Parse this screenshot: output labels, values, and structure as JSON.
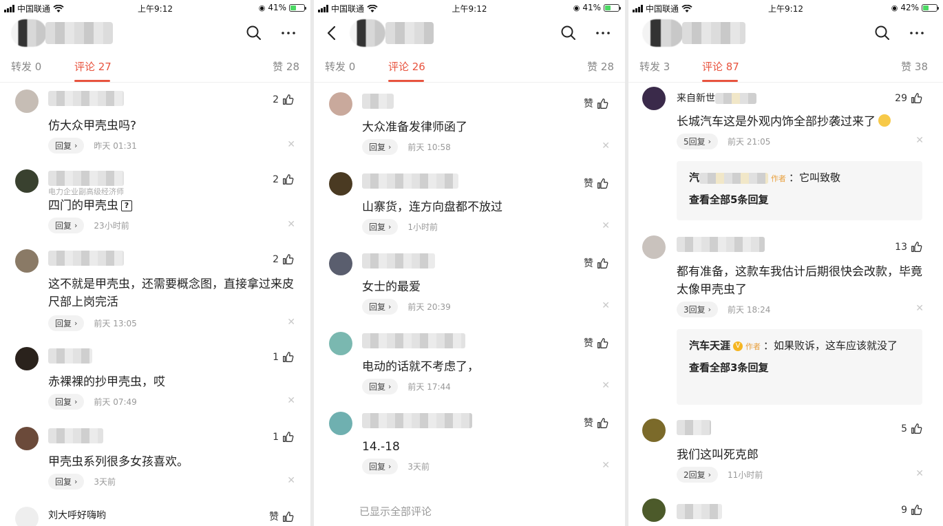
{
  "colors": {
    "accent": "#e8533e",
    "battery": "#4cd964"
  },
  "panels": [
    {
      "status": {
        "carrier": "中国联通",
        "time": "上午9:12",
        "battery": "41%",
        "battery_level": 0.41
      },
      "tabs": {
        "reposts": "转发 0",
        "comments": "评论 27",
        "likes": "赞 28"
      },
      "comments": [
        {
          "like": "2",
          "text": "仿大众甲壳虫吗?",
          "reply": "回复",
          "time": "昨天 01:31"
        },
        {
          "sub": "电力企业副高级经济师",
          "like": "2",
          "text": "四门的甲壳虫",
          "reply": "回复",
          "time": "23小时前"
        },
        {
          "like": "2",
          "text": "这不就是甲壳虫，还需要概念图，直接拿过来皮尺部上岗完活",
          "reply": "回复",
          "time": "前天 13:05"
        },
        {
          "like": "1",
          "text": "赤裸裸的抄甲壳虫，哎",
          "reply": "回复",
          "time": "前天 07:49"
        },
        {
          "like": "1",
          "text": "甲壳虫系列很多女孩喜欢。",
          "reply": "回复",
          "time": "3天前"
        },
        {
          "name": "刘大呼好嗨哟",
          "like": "赞"
        }
      ]
    },
    {
      "status": {
        "carrier": "中国联通",
        "time": "上午9:12",
        "battery": "41%",
        "battery_level": 0.41
      },
      "tabs": {
        "reposts": "转发 0",
        "comments": "评论 26",
        "likes": "赞 28"
      },
      "comments": [
        {
          "like": "赞",
          "text": "大众准备发律师函了",
          "reply": "回复",
          "time": "前天 10:58"
        },
        {
          "like": "赞",
          "text": "山寨货，连方向盘都不放过",
          "reply": "回复",
          "time": "1小时前"
        },
        {
          "like": "赞",
          "text": "女士的最爱",
          "reply": "回复",
          "time": "前天 20:39"
        },
        {
          "like": "赞",
          "text": "电动的话就不考虑了，",
          "reply": "回复",
          "time": "前天 17:44"
        },
        {
          "like": "赞",
          "text": "14.-18",
          "reply": "回复",
          "time": "3天前"
        }
      ],
      "end_note": "已显示全部评论"
    },
    {
      "status": {
        "carrier": "中国联通",
        "time": "上午9:12",
        "battery": "42%",
        "battery_level": 0.42
      },
      "tabs": {
        "reposts": "转发 3",
        "comments": "评论 87",
        "likes": "赞 38"
      },
      "comments": [
        {
          "name": "来自新世",
          "like": "29",
          "text": "长城汽车这是外观内饰全部抄袭过来了",
          "reply": "5回复",
          "time": "前天 21:05",
          "subbox": {
            "who": "汽",
            "author_tag": "作者",
            "text": "：它叫致敬",
            "see_all": "查看全部5条回复"
          }
        },
        {
          "like": "13",
          "text": "都有准备，这款车我估计后期很快会改款，毕竟太像甲壳虫了",
          "reply": "3回复",
          "time": "前天 18:24",
          "subbox": {
            "who": "汽车天涯",
            "badge": "V",
            "author_tag": "作者",
            "text": "：如果败诉，这车应该就没了",
            "see_all": "查看全部3条回复"
          }
        },
        {
          "like": "5",
          "text": "我们这叫死克郎",
          "reply": "2回复",
          "time": "11小时前"
        },
        {
          "like": "9"
        }
      ]
    }
  ]
}
